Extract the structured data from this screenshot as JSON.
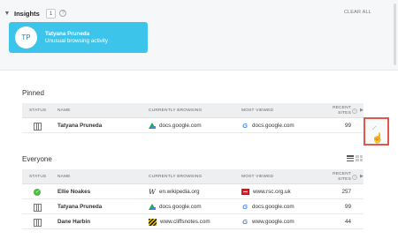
{
  "insights": {
    "title": "Insights",
    "count": "1",
    "help": "?",
    "clear_all": "CLEAR ALL",
    "card": {
      "initials": "TP",
      "name": "Tatyana Pruneda",
      "subtitle": "Unusual browsing activity"
    }
  },
  "columns": {
    "status": "STATUS",
    "name": "NAME",
    "currently": "CURRENTLY BROWSING",
    "most": "MOST VIEWED",
    "recent1": "RECENT",
    "recent2": "SITES"
  },
  "pinned": {
    "title": "Pinned",
    "rows": [
      {
        "status_icon": "book-icon",
        "name": "Tatyana Pruneda",
        "current_icon": "google-drive-icon",
        "current": "docs.google.com",
        "most_icon": "google-icon",
        "most": "docs.google.com",
        "recent": "99"
      }
    ]
  },
  "everyone": {
    "title": "Everyone",
    "rows": [
      {
        "status_icon": "check-icon",
        "name": "Ellie Noakes",
        "current_icon": "wikipedia-icon",
        "current": "en.wikipedia.org",
        "most_icon": "rsc-icon",
        "most": "www.rsc.org.uk",
        "recent": "257"
      },
      {
        "status_icon": "book-icon",
        "name": "Tatyana Pruneda",
        "current_icon": "google-drive-icon",
        "current": "docs.google.com",
        "most_icon": "google-icon",
        "most": "docs.google.com",
        "recent": "99"
      },
      {
        "status_icon": "book-icon",
        "name": "Dane Harbin",
        "current_icon": "cliffsnotes-icon",
        "current": "www.cliffsnotes.com",
        "most_icon": "google-icon",
        "most": "www.google.com",
        "recent": "44"
      }
    ]
  },
  "icons": {
    "wikipedia_glyph": "W",
    "google_glyph": "G",
    "check_glyph": "✓",
    "help_glyph": "?"
  },
  "colors": {
    "card_bg": "#3dc4ea",
    "highlight_border": "#e2574c",
    "online_green": "#52b846"
  }
}
